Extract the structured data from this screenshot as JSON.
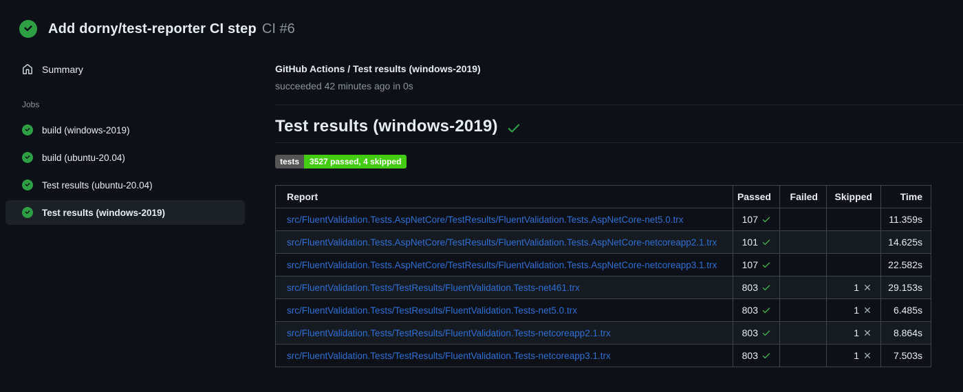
{
  "header": {
    "title": "Add dorny/test-reporter CI step",
    "run": "CI #6"
  },
  "sidebar": {
    "summary": "Summary",
    "jobs_heading": "Jobs",
    "jobs": [
      {
        "label": "build (windows-2019)",
        "selected": false
      },
      {
        "label": "build (ubuntu-20.04)",
        "selected": false
      },
      {
        "label": "Test results (ubuntu-20.04)",
        "selected": false
      },
      {
        "label": "Test results (windows-2019)",
        "selected": true
      }
    ]
  },
  "main": {
    "check_name": "GitHub Actions / Test results (windows-2019)",
    "check_status": "succeeded 42 minutes ago in 0s",
    "section_heading": "Test results (windows-2019)",
    "badge": {
      "label": "tests",
      "value": "3527 passed, 4 skipped"
    },
    "table": {
      "headers": {
        "report": "Report",
        "passed": "Passed",
        "failed": "Failed",
        "skipped": "Skipped",
        "time": "Time"
      },
      "rows": [
        {
          "report": "src/FluentValidation.Tests.AspNetCore/TestResults/FluentValidation.Tests.AspNetCore-net5.0.trx",
          "passed": "107",
          "failed": "",
          "skipped": "",
          "time": "11.359s"
        },
        {
          "report": "src/FluentValidation.Tests.AspNetCore/TestResults/FluentValidation.Tests.AspNetCore-netcoreapp2.1.trx",
          "passed": "101",
          "failed": "",
          "skipped": "",
          "time": "14.625s"
        },
        {
          "report": "src/FluentValidation.Tests.AspNetCore/TestResults/FluentValidation.Tests.AspNetCore-netcoreapp3.1.trx",
          "passed": "107",
          "failed": "",
          "skipped": "",
          "time": "22.582s"
        },
        {
          "report": "src/FluentValidation.Tests/TestResults/FluentValidation.Tests-net461.trx",
          "passed": "803",
          "failed": "",
          "skipped": "1",
          "time": "29.153s"
        },
        {
          "report": "src/FluentValidation.Tests/TestResults/FluentValidation.Tests-net5.0.trx",
          "passed": "803",
          "failed": "",
          "skipped": "1",
          "time": "6.485s"
        },
        {
          "report": "src/FluentValidation.Tests/TestResults/FluentValidation.Tests-netcoreapp2.1.trx",
          "passed": "803",
          "failed": "",
          "skipped": "1",
          "time": "8.864s"
        },
        {
          "report": "src/FluentValidation.Tests/TestResults/FluentValidation.Tests-netcoreapp3.1.trx",
          "passed": "803",
          "failed": "",
          "skipped": "1",
          "time": "7.503s"
        }
      ]
    }
  },
  "icons": {
    "run_status": "check-circle-fill",
    "summary": "home",
    "job_status": "check-circle-fill",
    "heading_mark": "check",
    "passed_mark": "check",
    "skipped_mark": "x"
  },
  "colors": {
    "background": "#0d1117",
    "row_alt": "#161b22",
    "selected_item_bg": "#1c2128",
    "border": "#3d444d",
    "muted_text": "#8b949e",
    "success_green": "#2ea043",
    "check_green": "#3fb950",
    "link_blue": "#2f6fd4",
    "badge_label_bg": "#555555",
    "badge_value_bg": "#44cc11"
  }
}
